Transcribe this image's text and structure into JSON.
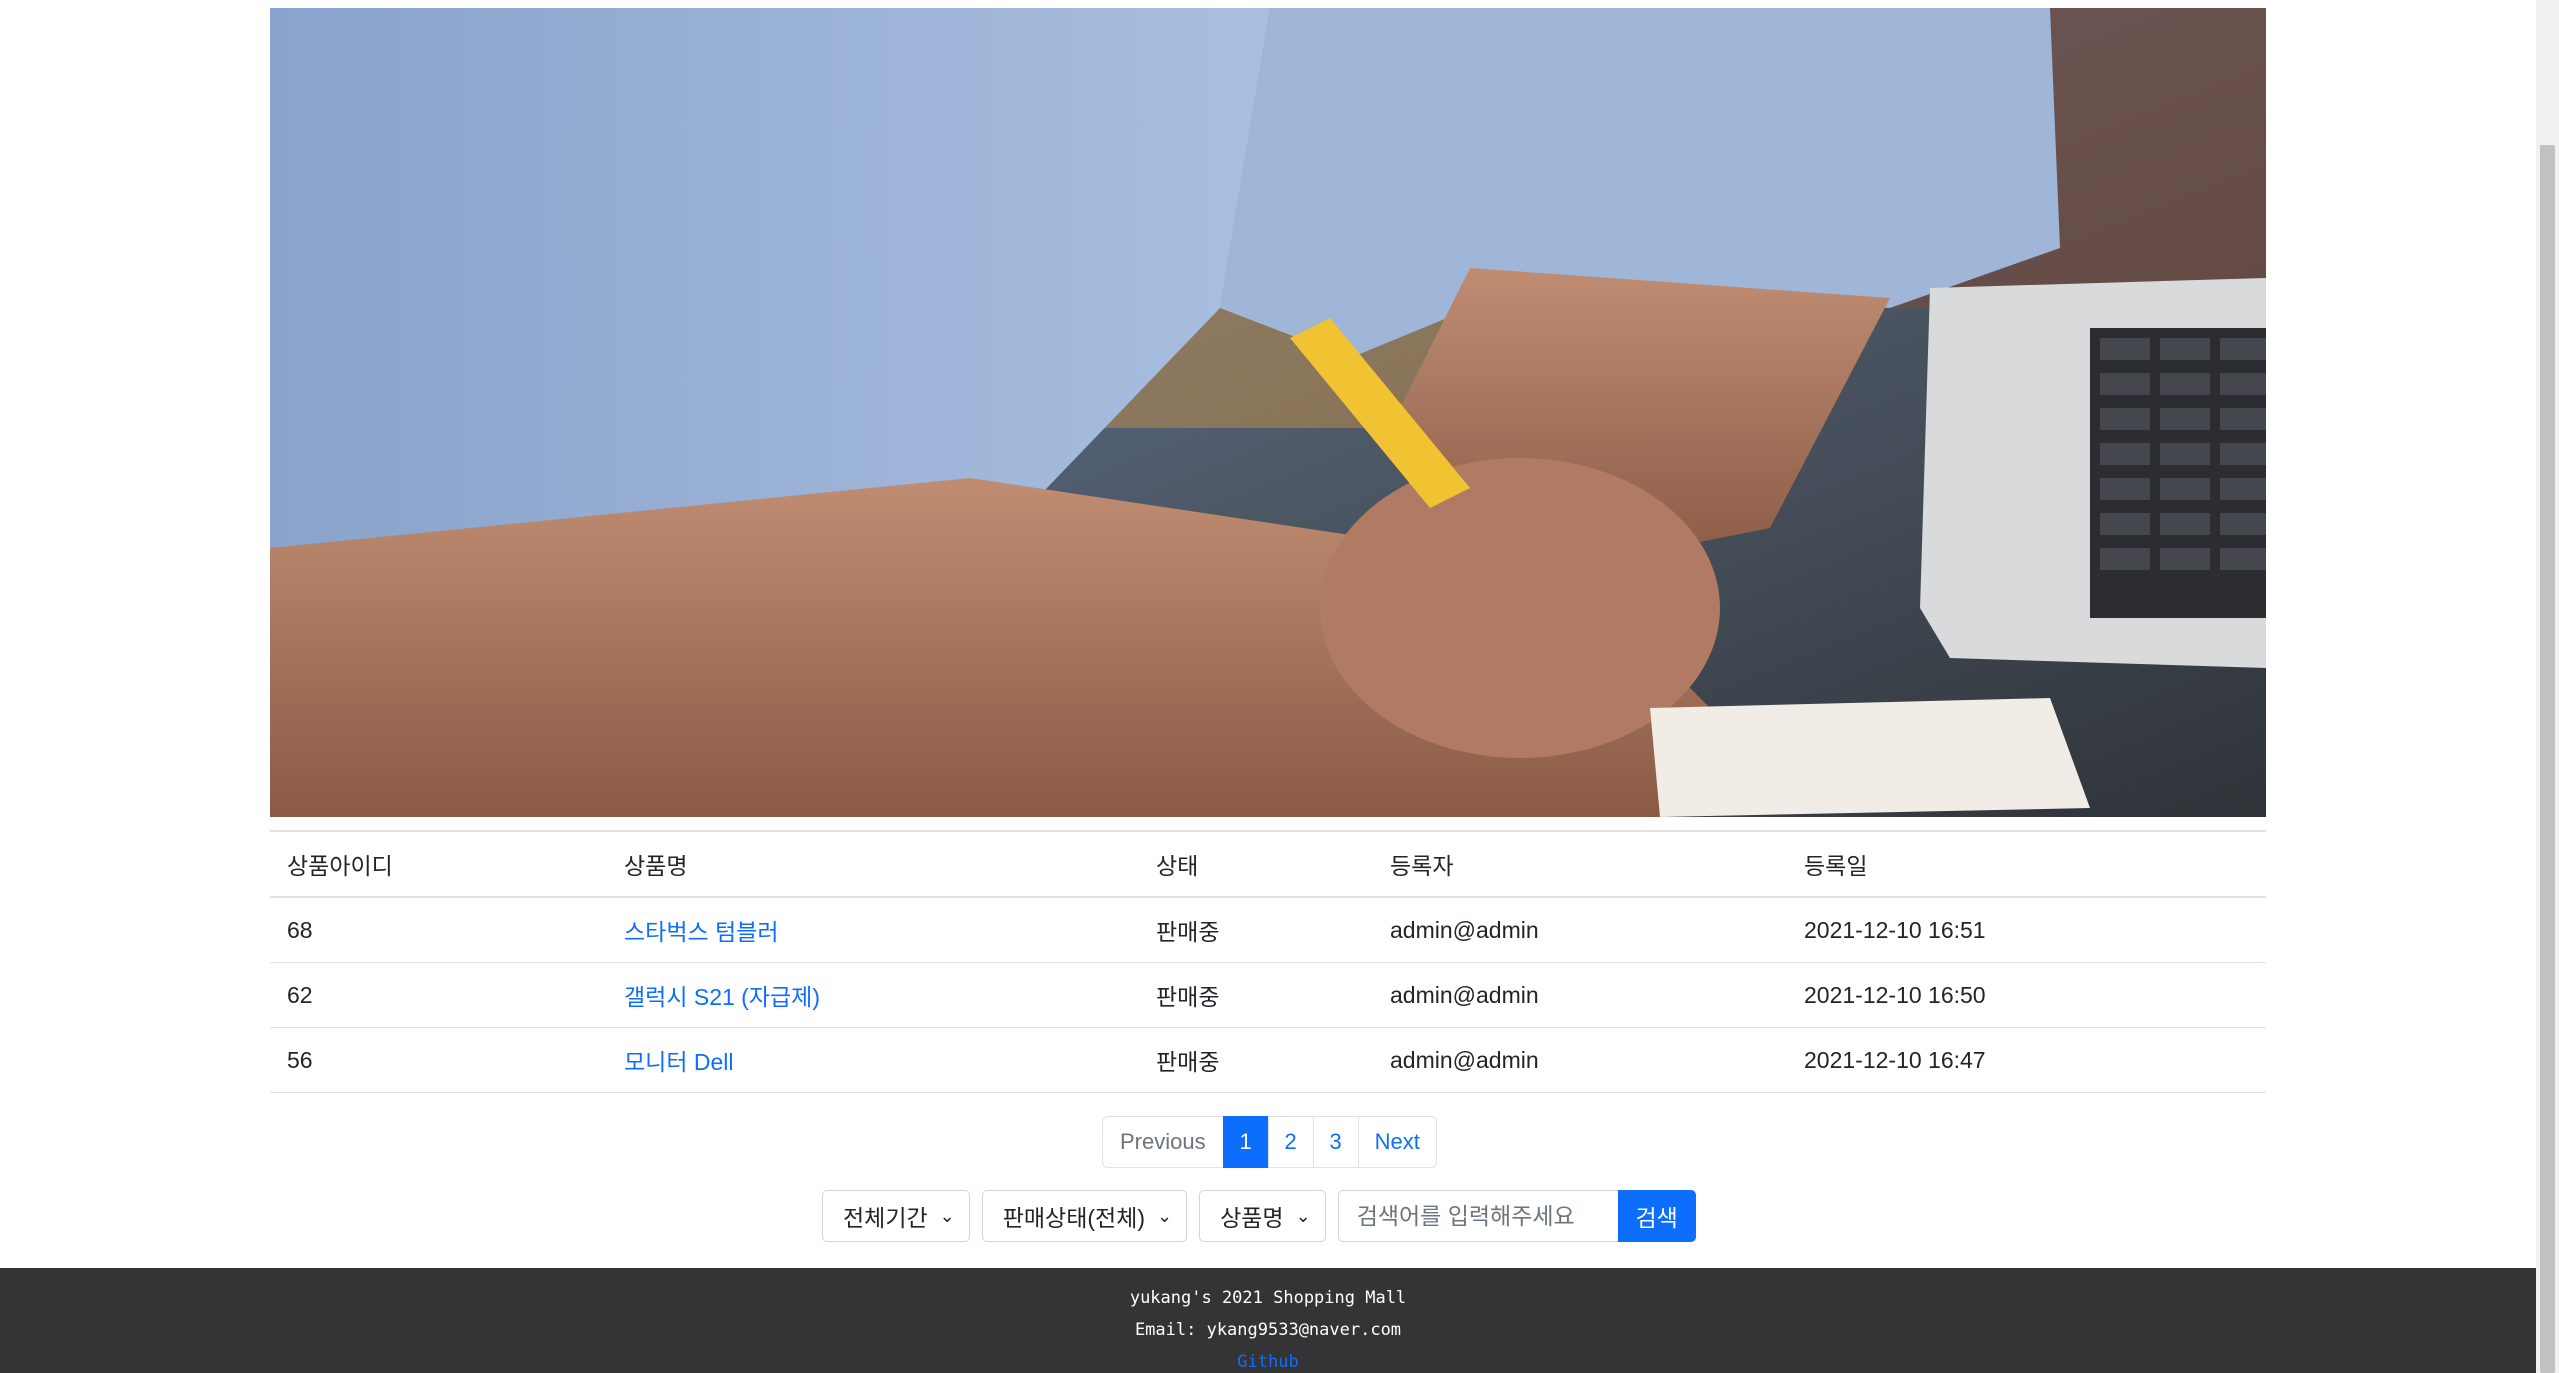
{
  "hero": {
    "image": "person-writing-at-laptop-photo"
  },
  "table": {
    "headers": [
      "상품아이디",
      "상품명",
      "상태",
      "등록자",
      "등록일"
    ],
    "rows": [
      {
        "id": "68",
        "name": "스타벅스 텀블러",
        "status": "판매중",
        "author": "admin@admin",
        "date": "2021-12-10 16:51"
      },
      {
        "id": "62",
        "name": "갤럭시 S21 (자급제)",
        "status": "판매중",
        "author": "admin@admin",
        "date": "2021-12-10 16:50"
      },
      {
        "id": "56",
        "name": "모니터 Dell",
        "status": "판매중",
        "author": "admin@admin",
        "date": "2021-12-10 16:47"
      }
    ]
  },
  "pagination": {
    "previous": "Previous",
    "pages": [
      "1",
      "2",
      "3"
    ],
    "active": "1",
    "next": "Next"
  },
  "search": {
    "period": "전체기간",
    "status": "판매상태(전체)",
    "field": "상품명",
    "placeholder": "검색어를 입력해주세요",
    "button": "검색"
  },
  "footer": {
    "title": "yukang's 2021 Shopping Mall",
    "email": "Email: ykang9533@naver.com",
    "github": "Github"
  },
  "colors": {
    "primary": "#0d6efd",
    "footer_bg": "#343434"
  }
}
